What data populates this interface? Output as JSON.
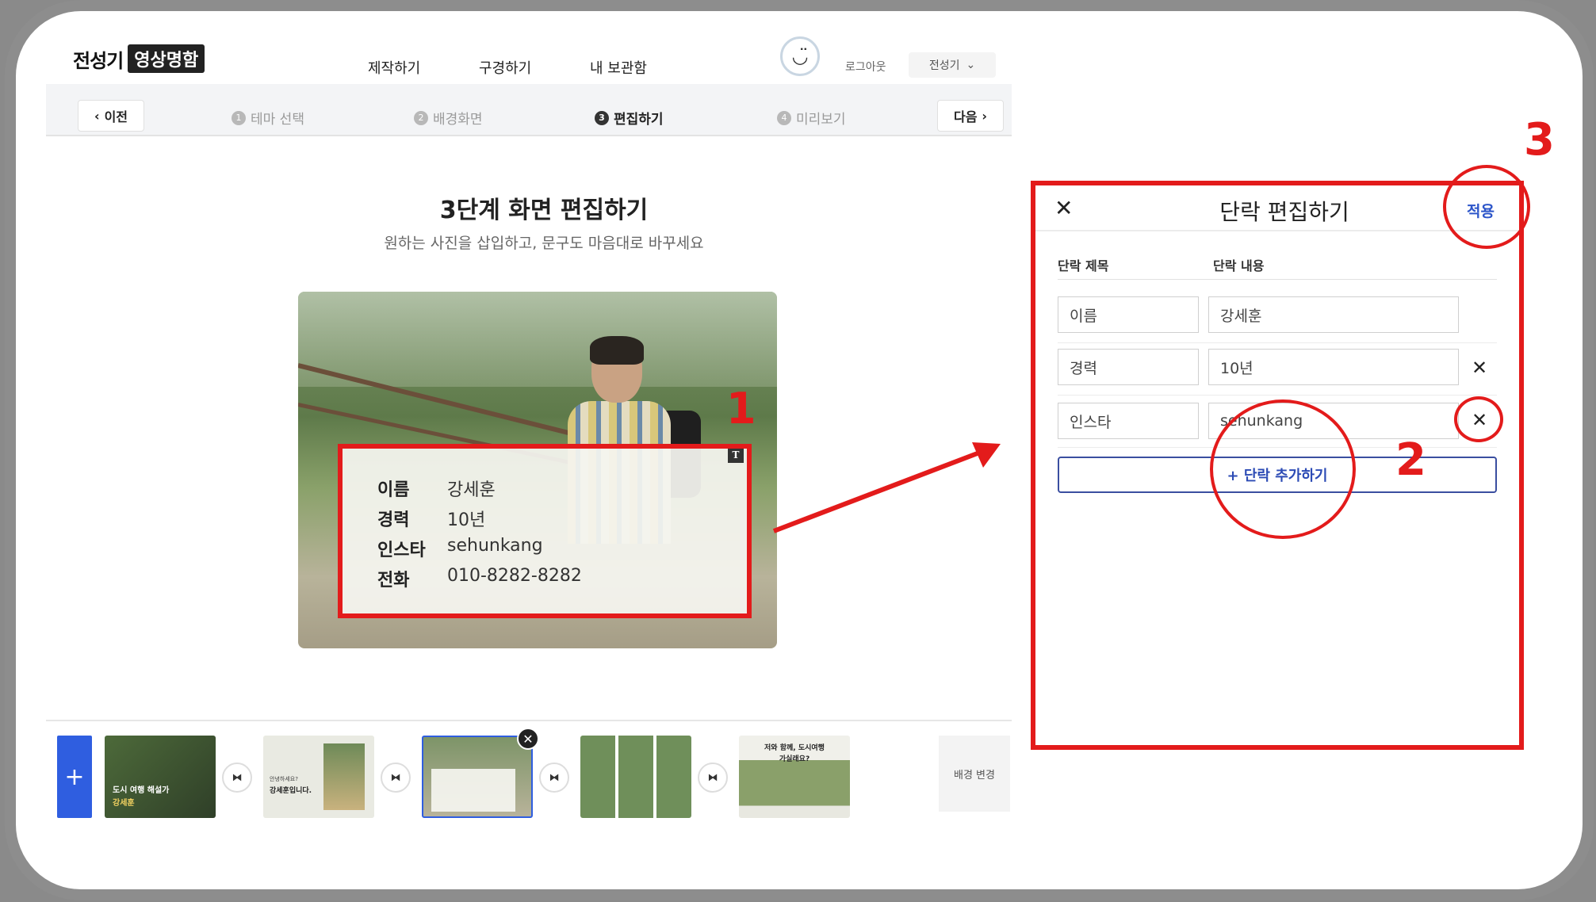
{
  "header": {
    "logo_part1": "전성기",
    "logo_part2": "영상명함",
    "nav": [
      "제작하기",
      "구경하기",
      "내 보관함"
    ],
    "avatar": "◡̈",
    "logout": "로그아웃",
    "user": "전성기",
    "user_chevron": "⌄"
  },
  "steps": {
    "prev": "이전",
    "next": "다음",
    "items": [
      {
        "num": "1",
        "label": "테마 선택"
      },
      {
        "num": "2",
        "label": "배경화면"
      },
      {
        "num": "3",
        "label": "편집하기"
      },
      {
        "num": "4",
        "label": "미리보기"
      }
    ],
    "active_index": 2
  },
  "main": {
    "title": "3단계 화면 편집하기",
    "subtitle": "원하는 사진을 삽입하고, 문구도 마음대로 바꾸세요",
    "text_badge": "T",
    "card_rows": [
      {
        "key": "이름",
        "value": "강세훈"
      },
      {
        "key": "경력",
        "value": "10년"
      },
      {
        "key": "인스타",
        "value": "sehunkang"
      },
      {
        "key": "전화",
        "value": "010-8282-8282"
      }
    ]
  },
  "strip": {
    "add": "+",
    "thumbs": [
      {
        "line1": "도시 여행 해설가",
        "line2": "강세훈"
      },
      {
        "line1": "안녕하세요?",
        "line2": "강세훈입니다."
      },
      {
        "line1": "",
        "line2": ""
      },
      {
        "line1": "",
        "line2": ""
      },
      {
        "line1": "저와 함께, 도시여행",
        "line2": "가실래요?"
      }
    ],
    "transition_icon": "⧓",
    "thumb_close": "✕",
    "bg_change": "배경 변경"
  },
  "editor": {
    "close": "✕",
    "title": "단락 편집하기",
    "apply": "적용",
    "col_title": "단락 제목",
    "col_content": "단락 내용",
    "rows": [
      {
        "title": "이름",
        "content": "강세훈",
        "deletable": false
      },
      {
        "title": "경력",
        "content": "10년",
        "deletable": true
      },
      {
        "title": "인스타",
        "content": "sehunkang",
        "deletable": true
      }
    ],
    "delete_icon": "✕",
    "add_label": "+ 단락 추가하기"
  },
  "annotations": {
    "n1": "1",
    "n2": "2",
    "n3": "3"
  },
  "colors": {
    "accent": "#2f5ee0",
    "annotation": "#e31b1b",
    "apply": "#2c55c9"
  }
}
